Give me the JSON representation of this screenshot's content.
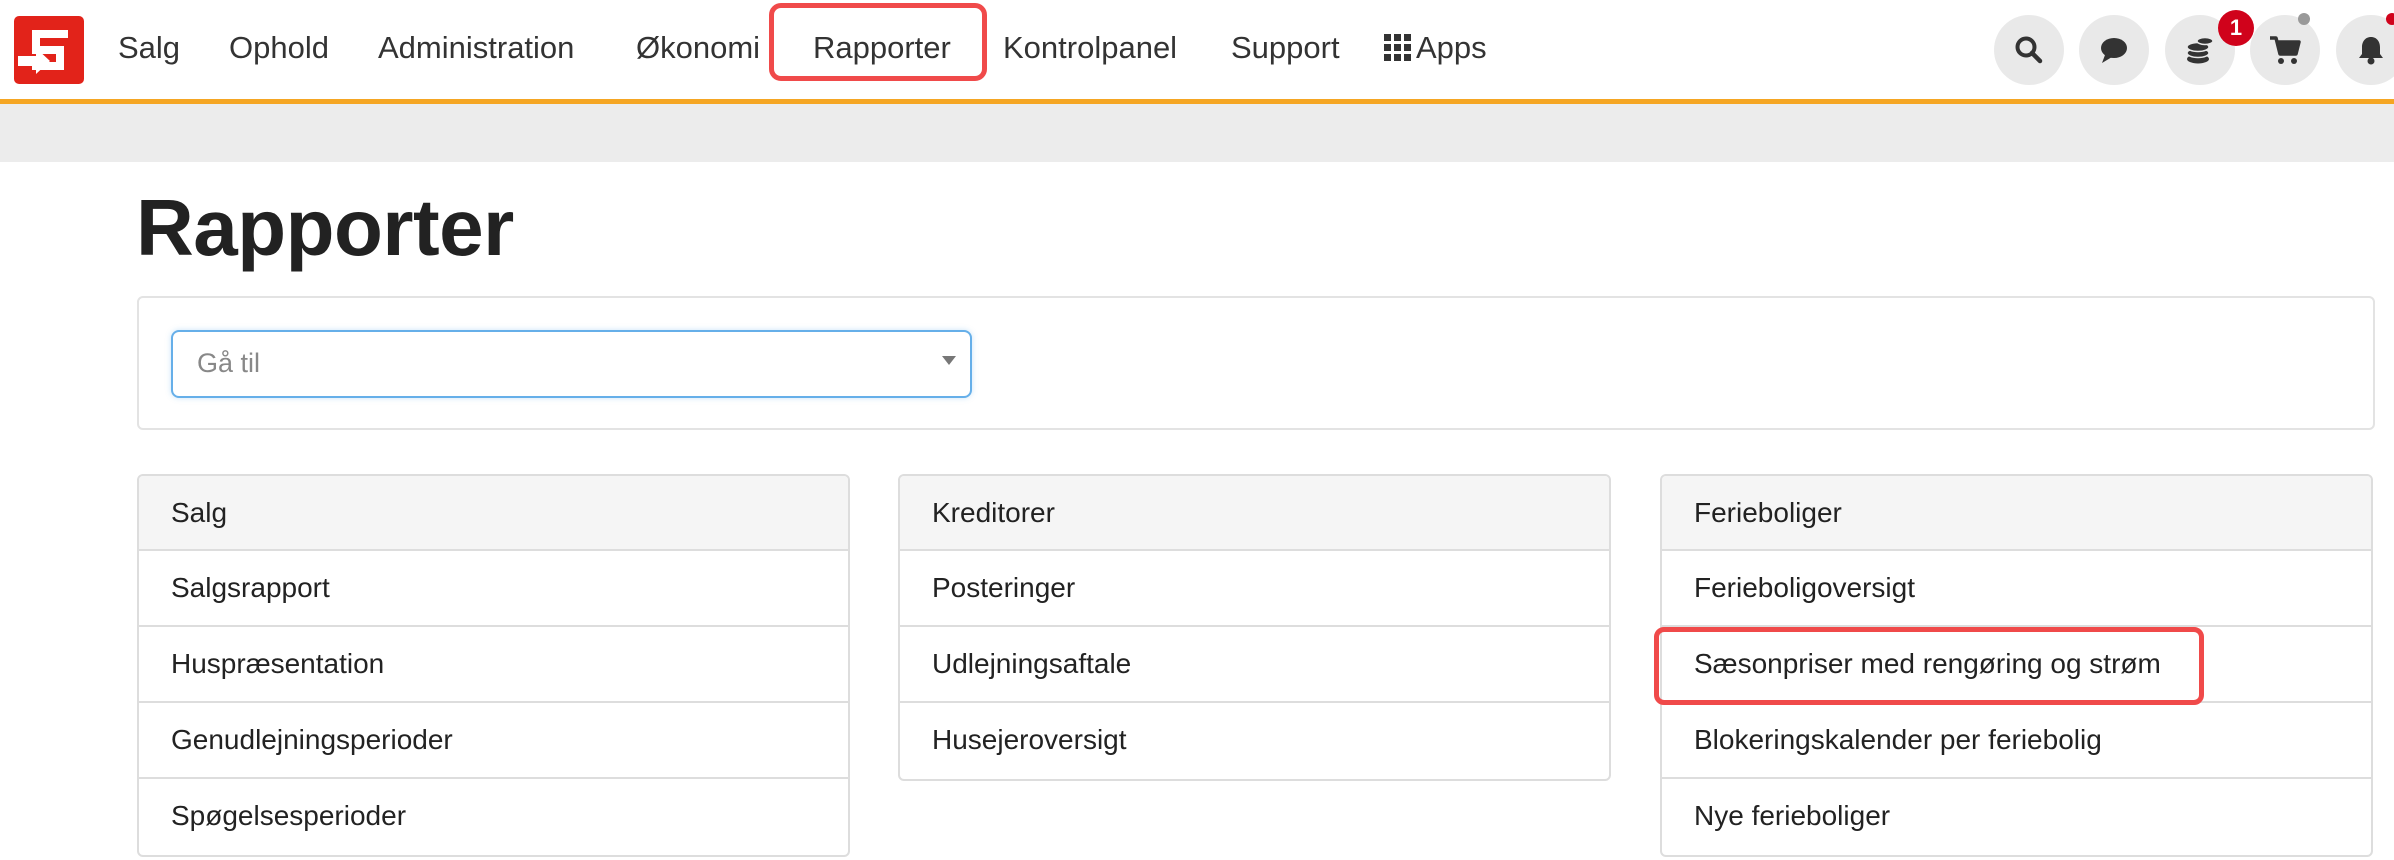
{
  "nav": {
    "items": [
      "Salg",
      "Ophold",
      "Administration",
      "Økonomi",
      "Rapporter",
      "Kontrolpanel",
      "Support",
      "Apps"
    ],
    "active": "Rapporter",
    "badge_count": "1",
    "icons": [
      "search-icon",
      "chat-icon",
      "coins-icon",
      "cart-icon",
      "bell-icon"
    ]
  },
  "page": {
    "title": "Rapporter"
  },
  "goto": {
    "placeholder": "Gå til"
  },
  "columns": [
    {
      "heading": "Salg",
      "items": [
        "Salgsrapport",
        "Huspræsentation",
        "Genudlejningsperioder",
        "Spøgelsesperioder"
      ]
    },
    {
      "heading": "Kreditorer",
      "items": [
        "Posteringer",
        "Udlejningsaftale",
        "Husejeroversigt"
      ]
    },
    {
      "heading": "Ferieboliger",
      "items": [
        "Ferieboligoversigt",
        "Sæsonpriser med rengøring og strøm",
        "Blokeringskalender per feriebolig",
        "Nye ferieboliger"
      ]
    }
  ],
  "colors": {
    "brand_red": "#e2231a",
    "accent_orange": "#f5a623",
    "highlight_red": "#f04a4a",
    "badge_red": "#d0021b",
    "focus_blue": "#66afe9"
  }
}
